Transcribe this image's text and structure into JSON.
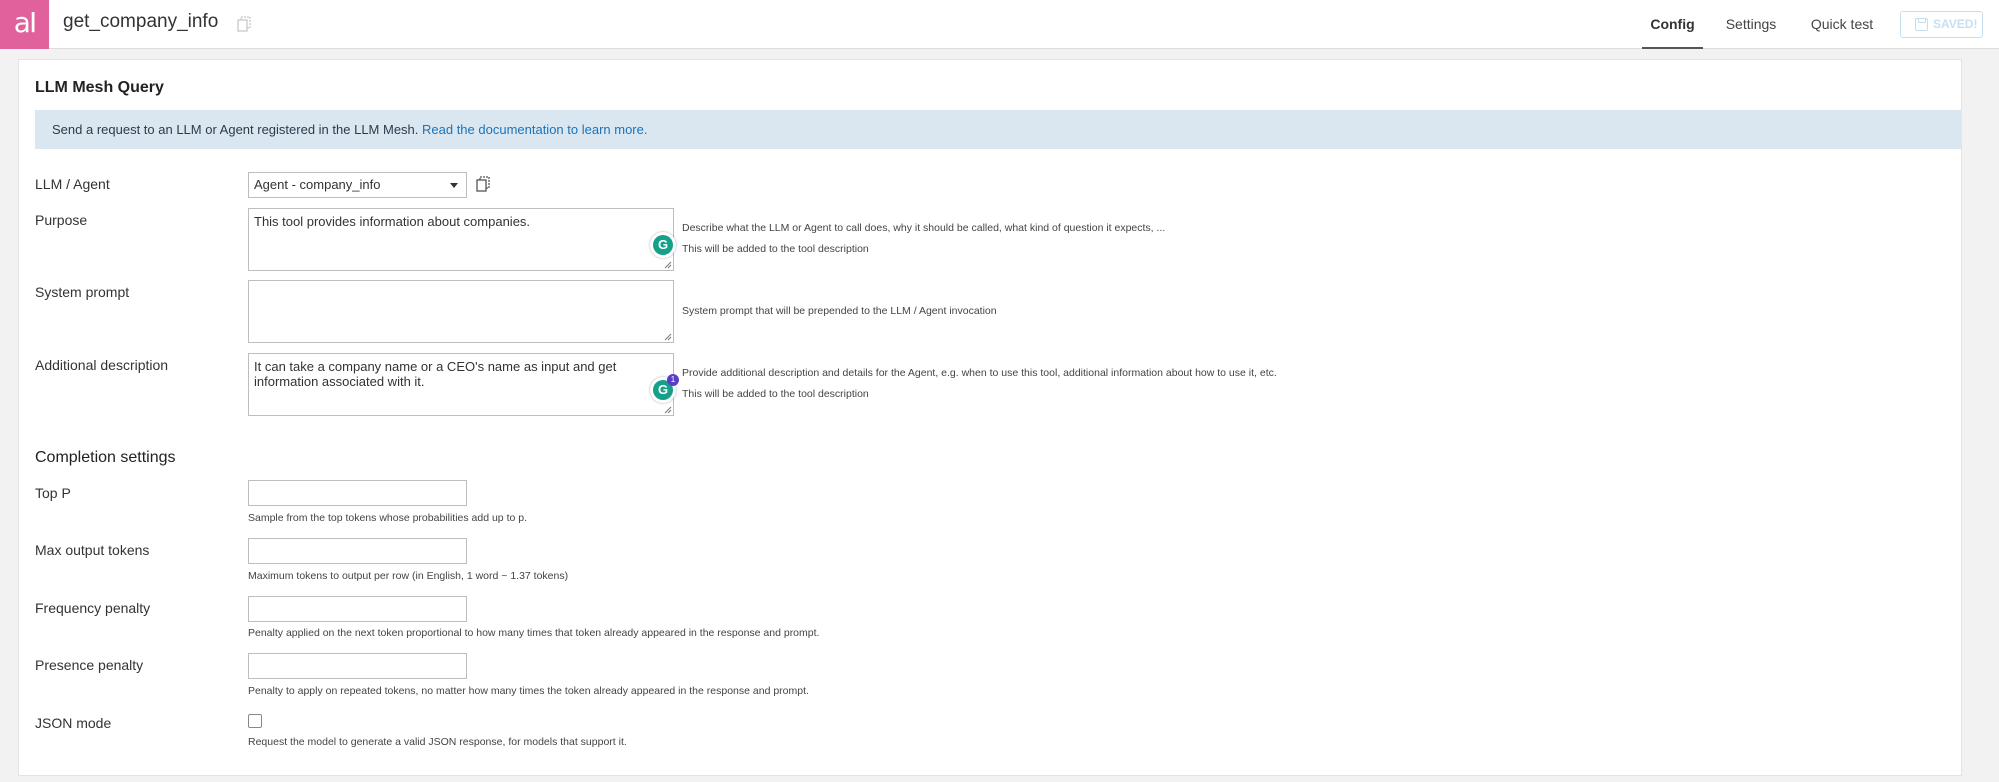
{
  "header": {
    "logo_text": "aI",
    "title": "get_company_info",
    "tabs": [
      {
        "label": "Config",
        "active": true
      },
      {
        "label": "Settings",
        "active": false
      },
      {
        "label": "Quick test",
        "active": false
      }
    ],
    "saved_label": "SAVED!"
  },
  "section": {
    "title": "LLM Mesh Query",
    "banner_text": "Send a request to an LLM or Agent registered in the LLM Mesh. ",
    "banner_link": "Read the documentation to learn more."
  },
  "fields": {
    "llm": {
      "label": "LLM / Agent",
      "value": "Agent - company_info"
    },
    "purpose": {
      "label": "Purpose",
      "value": "This tool provides information about companies.",
      "help": "Describe what the LLM or Agent to call does, why it should be called, what kind of question it expects, ...",
      "help2": "This will be added to the tool description"
    },
    "system_prompt": {
      "label": "System prompt",
      "value": "",
      "help": "System prompt that will be prepended to the LLM / Agent invocation"
    },
    "additional_description": {
      "label": "Additional description",
      "value": "It can take a company name or a CEO's name as input and get information associated with it.",
      "help": "Provide additional description and details for the Agent, e.g. when to use this tool, additional information about how to use it, etc.",
      "help2": "This will be added to the tool description",
      "grammarly_count": "1"
    }
  },
  "completion": {
    "title": "Completion settings",
    "top_p": {
      "label": "Top P",
      "value": "",
      "help": "Sample from the top tokens whose probabilities add up to p."
    },
    "max_output_tokens": {
      "label": "Max output tokens",
      "value": "",
      "help": "Maximum tokens to output per row (in English, 1 word ~ 1.37 tokens)"
    },
    "frequency_penalty": {
      "label": "Frequency penalty",
      "value": "",
      "help": "Penalty applied on the next token proportional to how many times that token already appeared in the response and prompt."
    },
    "presence_penalty": {
      "label": "Presence penalty",
      "value": "",
      "help": "Penalty to apply on repeated tokens, no matter how many times the token already appeared in the response and prompt."
    },
    "json_mode": {
      "label": "JSON mode",
      "checked": false,
      "help": "Request the model to generate a valid JSON response, for models that support it."
    }
  },
  "colors": {
    "logo_bg": "#e0619b",
    "banner_bg": "#dbe7f0",
    "link": "#1c73b9",
    "grammarly": "#15a08a"
  },
  "icons": [
    "copy-icon",
    "caret-down-icon",
    "save-disk-icon",
    "grammarly-icon",
    "resize-handle-icon"
  ]
}
